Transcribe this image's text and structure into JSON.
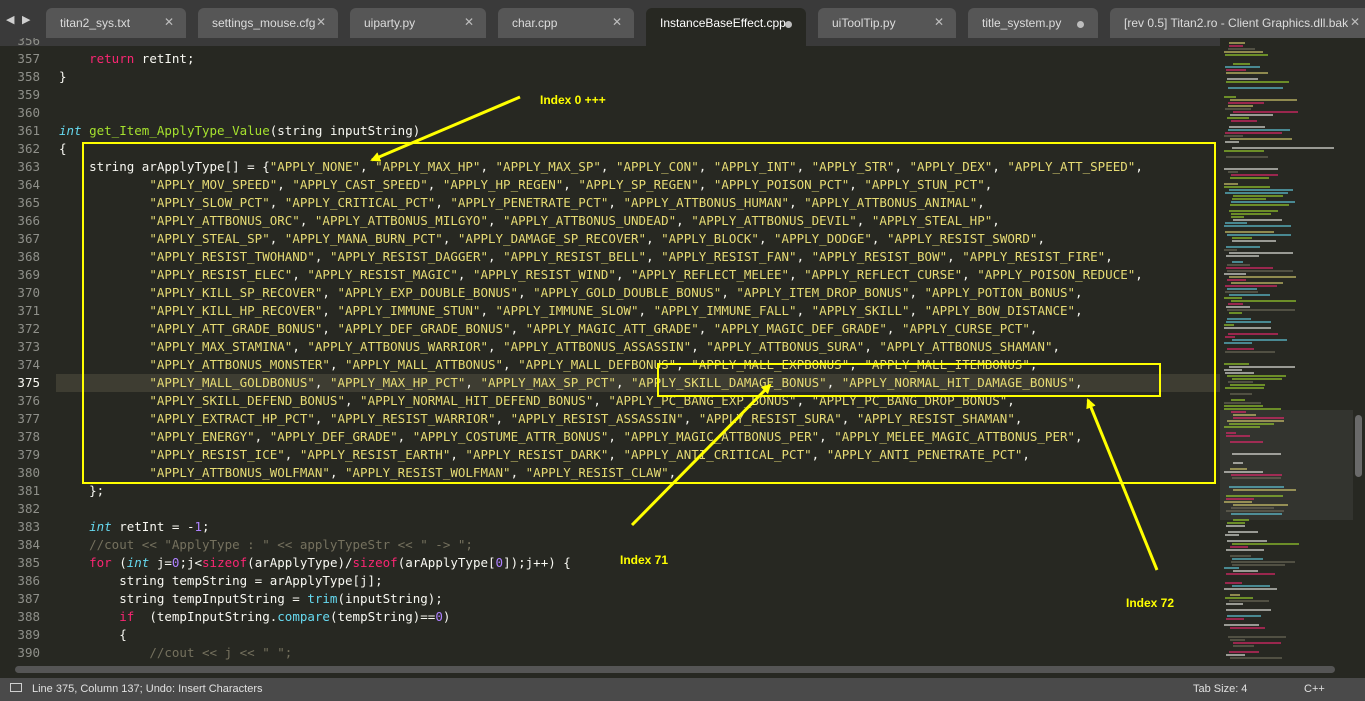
{
  "tabs": [
    {
      "label": "titan2_sys.txt",
      "marker": "close"
    },
    {
      "label": "settings_mouse.cfg",
      "marker": "close"
    },
    {
      "label": "uiparty.py",
      "marker": "close"
    },
    {
      "label": "char.cpp",
      "marker": "close"
    },
    {
      "label": "InstanceBaseEffect.cpp",
      "marker": "dot",
      "active": true
    },
    {
      "label": "uiToolTip.py",
      "marker": "close"
    },
    {
      "label": "title_system.py",
      "marker": "dot"
    },
    {
      "label": "[rev 0.5] Titan2.ro - Client Graphics.dll.bak",
      "marker": "close"
    }
  ],
  "tabbar": {
    "nav": "◀ ▶",
    "close_glyph": "✕"
  },
  "editor": {
    "current_line": "375",
    "lines": [
      {
        "num": "356",
        "html": ""
      },
      {
        "num": "357",
        "html": "    <span class=\"k\">return</span> retInt;"
      },
      {
        "num": "358",
        "html": "}"
      },
      {
        "num": "359",
        "html": ""
      },
      {
        "num": "360",
        "html": ""
      },
      {
        "num": "361",
        "html": "<span class=\"t\">int</span> <span class=\"f\">get_Item_ApplyType_Value</span>(string inputString)"
      },
      {
        "num": "362",
        "html": "{"
      },
      {
        "num": "363",
        "html": "    string arApplyType[] = {<span class=\"s\">\"APPLY_NONE\"</span>, <span class=\"s\">\"APPLY_MAX_HP\"</span>, <span class=\"s\">\"APPLY_MAX_SP\"</span>, <span class=\"s\">\"APPLY_CON\"</span>, <span class=\"s\">\"APPLY_INT\"</span>, <span class=\"s\">\"APPLY_STR\"</span>, <span class=\"s\">\"APPLY_DEX\"</span>, <span class=\"s\">\"APPLY_ATT_SPEED\"</span>,"
      },
      {
        "num": "364",
        "html": "            <span class=\"s\">\"APPLY_MOV_SPEED\"</span>, <span class=\"s\">\"APPLY_CAST_SPEED\"</span>, <span class=\"s\">\"APPLY_HP_REGEN\"</span>, <span class=\"s\">\"APPLY_SP_REGEN\"</span>, <span class=\"s\">\"APPLY_POISON_PCT\"</span>, <span class=\"s\">\"APPLY_STUN_PCT\"</span>,"
      },
      {
        "num": "365",
        "html": "            <span class=\"s\">\"APPLY_SLOW_PCT\"</span>, <span class=\"s\">\"APPLY_CRITICAL_PCT\"</span>, <span class=\"s\">\"APPLY_PENETRATE_PCT\"</span>, <span class=\"s\">\"APPLY_ATTBONUS_HUMAN\"</span>, <span class=\"s\">\"APPLY_ATTBONUS_ANIMAL\"</span>,"
      },
      {
        "num": "366",
        "html": "            <span class=\"s\">\"APPLY_ATTBONUS_ORC\"</span>, <span class=\"s\">\"APPLY_ATTBONUS_MILGYO\"</span>, <span class=\"s\">\"APPLY_ATTBONUS_UNDEAD\"</span>, <span class=\"s\">\"APPLY_ATTBONUS_DEVIL\"</span>, <span class=\"s\">\"APPLY_STEAL_HP\"</span>,"
      },
      {
        "num": "367",
        "html": "            <span class=\"s\">\"APPLY_STEAL_SP\"</span>, <span class=\"s\">\"APPLY_MANA_BURN_PCT\"</span>, <span class=\"s\">\"APPLY_DAMAGE_SP_RECOVER\"</span>, <span class=\"s\">\"APPLY_BLOCK\"</span>, <span class=\"s\">\"APPLY_DODGE\"</span>, <span class=\"s\">\"APPLY_RESIST_SWORD\"</span>,"
      },
      {
        "num": "368",
        "html": "            <span class=\"s\">\"APPLY_RESIST_TWOHAND\"</span>, <span class=\"s\">\"APPLY_RESIST_DAGGER\"</span>, <span class=\"s\">\"APPLY_RESIST_BELL\"</span>, <span class=\"s\">\"APPLY_RESIST_FAN\"</span>, <span class=\"s\">\"APPLY_RESIST_BOW\"</span>, <span class=\"s\">\"APPLY_RESIST_FIRE\"</span>,"
      },
      {
        "num": "369",
        "html": "            <span class=\"s\">\"APPLY_RESIST_ELEC\"</span>, <span class=\"s\">\"APPLY_RESIST_MAGIC\"</span>, <span class=\"s\">\"APPLY_RESIST_WIND\"</span>, <span class=\"s\">\"APPLY_REFLECT_MELEE\"</span>, <span class=\"s\">\"APPLY_REFLECT_CURSE\"</span>, <span class=\"s\">\"APPLY_POISON_REDUCE\"</span>,"
      },
      {
        "num": "370",
        "html": "            <span class=\"s\">\"APPLY_KILL_SP_RECOVER\"</span>, <span class=\"s\">\"APPLY_EXP_DOUBLE_BONUS\"</span>, <span class=\"s\">\"APPLY_GOLD_DOUBLE_BONUS\"</span>, <span class=\"s\">\"APPLY_ITEM_DROP_BONUS\"</span>, <span class=\"s\">\"APPLY_POTION_BONUS\"</span>,"
      },
      {
        "num": "371",
        "html": "            <span class=\"s\">\"APPLY_KILL_HP_RECOVER\"</span>, <span class=\"s\">\"APPLY_IMMUNE_STUN\"</span>, <span class=\"s\">\"APPLY_IMMUNE_SLOW\"</span>, <span class=\"s\">\"APPLY_IMMUNE_FALL\"</span>, <span class=\"s\">\"APPLY_SKILL\"</span>, <span class=\"s\">\"APPLY_BOW_DISTANCE\"</span>,"
      },
      {
        "num": "372",
        "html": "            <span class=\"s\">\"APPLY_ATT_GRADE_BONUS\"</span>, <span class=\"s\">\"APPLY_DEF_GRADE_BONUS\"</span>, <span class=\"s\">\"APPLY_MAGIC_ATT_GRADE\"</span>, <span class=\"s\">\"APPLY_MAGIC_DEF_GRADE\"</span>, <span class=\"s\">\"APPLY_CURSE_PCT\"</span>,"
      },
      {
        "num": "373",
        "html": "            <span class=\"s\">\"APPLY_MAX_STAMINA\"</span>, <span class=\"s\">\"APPLY_ATTBONUS_WARRIOR\"</span>, <span class=\"s\">\"APPLY_ATTBONUS_ASSASSIN\"</span>, <span class=\"s\">\"APPLY_ATTBONUS_SURA\"</span>, <span class=\"s\">\"APPLY_ATTBONUS_SHAMAN\"</span>,"
      },
      {
        "num": "374",
        "html": "            <span class=\"s\">\"APPLY_ATTBONUS_MONSTER\"</span>, <span class=\"s\">\"APPLY_MALL_ATTBONUS\"</span>, <span class=\"s\">\"APPLY_MALL_DEFBONUS\"</span>, <span class=\"s\">\"APPLY_MALL_EXPBONUS\"</span>, <span class=\"s\">\"APPLY_MALL_ITEMBONUS\"</span>,"
      },
      {
        "num": "375",
        "html": "            <span class=\"s\">\"APPLY_MALL_GOLDBONUS\"</span>, <span class=\"s\">\"APPLY_MAX_HP_PCT\"</span>, <span class=\"s\">\"APPLY_MAX_SP_PCT\"</span>, <span class=\"s\">\"APPLY_SKILL_DAMAGE_BONUS\"</span>, <span class=\"s\">\"APPLY_NORMAL_HIT_DAMAGE_BONUS\"</span>,"
      },
      {
        "num": "376",
        "html": "            <span class=\"s\">\"APPLY_SKILL_DEFEND_BONUS\"</span>, <span class=\"s\">\"APPLY_NORMAL_HIT_DEFEND_BONUS\"</span>, <span class=\"s\">\"APPLY_PC_BANG_EXP_BONUS\"</span>, <span class=\"s\">\"APPLY_PC_BANG_DROP_BONUS\"</span>,"
      },
      {
        "num": "377",
        "html": "            <span class=\"s\">\"APPLY_EXTRACT_HP_PCT\"</span>, <span class=\"s\">\"APPLY_RESIST_WARRIOR\"</span>, <span class=\"s\">\"APPLY_RESIST_ASSASSIN\"</span>, <span class=\"s\">\"APPLY_RESIST_SURA\"</span>, <span class=\"s\">\"APPLY_RESIST_SHAMAN\"</span>,"
      },
      {
        "num": "378",
        "html": "            <span class=\"s\">\"APPLY_ENERGY\"</span>, <span class=\"s\">\"APPLY_DEF_GRADE\"</span>, <span class=\"s\">\"APPLY_COSTUME_ATTR_BONUS\"</span>, <span class=\"s\">\"APPLY_MAGIC_ATTBONUS_PER\"</span>, <span class=\"s\">\"APPLY_MELEE_MAGIC_ATTBONUS_PER\"</span>,"
      },
      {
        "num": "379",
        "html": "            <span class=\"s\">\"APPLY_RESIST_ICE\"</span>, <span class=\"s\">\"APPLY_RESIST_EARTH\"</span>, <span class=\"s\">\"APPLY_RESIST_DARK\"</span>, <span class=\"s\">\"APPLY_ANTI_CRITICAL_PCT\"</span>, <span class=\"s\">\"APPLY_ANTI_PENETRATE_PCT\"</span>,"
      },
      {
        "num": "380",
        "html": "            <span class=\"s\">\"APPLY_ATTBONUS_WOLFMAN\"</span>, <span class=\"s\">\"APPLY_RESIST_WOLFMAN\"</span>, <span class=\"s\">\"APPLY_RESIST_CLAW\"</span>,"
      },
      {
        "num": "381",
        "html": "    };"
      },
      {
        "num": "382",
        "html": ""
      },
      {
        "num": "383",
        "html": "    <span class=\"t\">int</span> retInt = -<span class=\"n\">1</span>;"
      },
      {
        "num": "384",
        "html": "    <span class=\"c\">//cout &lt;&lt; \"ApplyType : \" &lt;&lt; applyTypeStr &lt;&lt; \" -&gt; \";</span>"
      },
      {
        "num": "385",
        "html": "    <span class=\"k\">for</span> (<span class=\"t\">int</span> j=<span class=\"n\">0</span>;j&lt;<span class=\"k\">sizeof</span>(arApplyType)/<span class=\"k\">sizeof</span>(arApplyType[<span class=\"n\">0</span>]);j++) {"
      },
      {
        "num": "386",
        "html": "        string tempString = arApplyType[j];"
      },
      {
        "num": "387",
        "html": "        string tempInputString = <span class=\"b\">trim</span>(inputString);"
      },
      {
        "num": "388",
        "html": "        <span class=\"k\">if</span>  (tempInputString.<span class=\"b\">compare</span>(tempString)==<span class=\"n\">0</span>)"
      },
      {
        "num": "389",
        "html": "        {"
      },
      {
        "num": "390",
        "html": "            <span class=\"c\">//cout &lt;&lt; j &lt;&lt; \" \";</span>"
      }
    ]
  },
  "annotations": {
    "index0": "Index 0 +++",
    "index71": "Index 71",
    "index72": "Index 72",
    "color": "#ffff00"
  },
  "statusbar": {
    "text": "Line 375, Column 137; Undo: Insert Characters",
    "tab_size": "Tab Size: 4",
    "syntax": "C++"
  }
}
